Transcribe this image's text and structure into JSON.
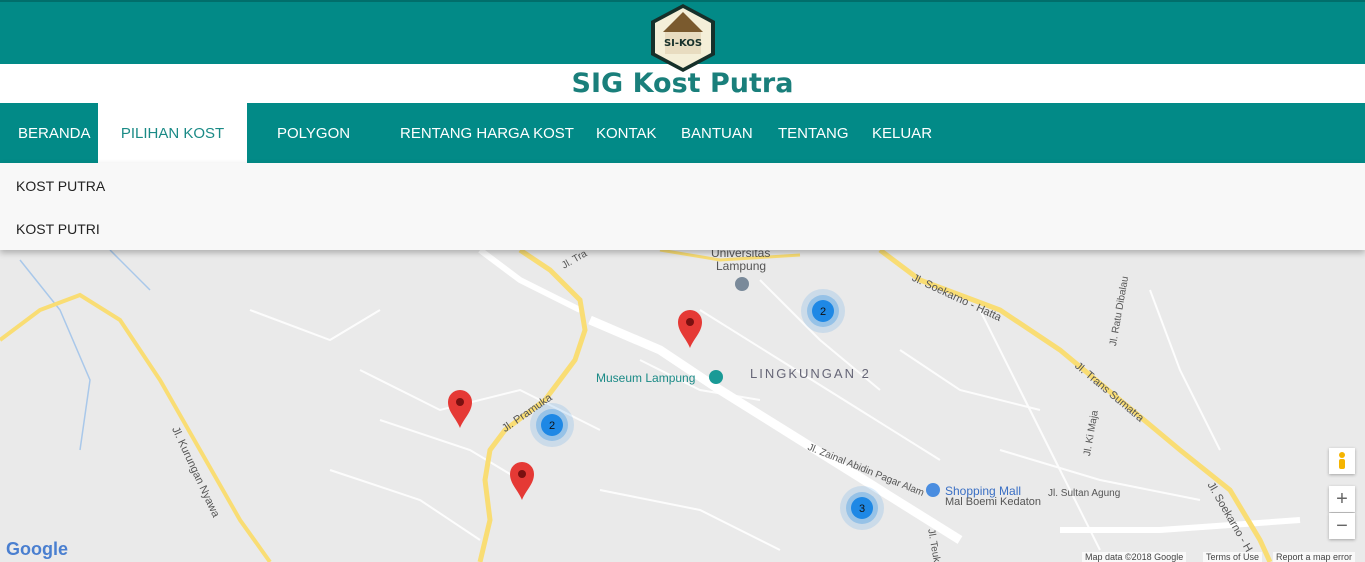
{
  "header": {
    "title": "SIG Kost Putra",
    "logo_text": "SI-KOS"
  },
  "nav": {
    "items": [
      {
        "label": "BERANDA"
      },
      {
        "label": "PILIHAN KOST"
      },
      {
        "label": "POLYGON"
      },
      {
        "label": "RENTANG HARGA KOST"
      },
      {
        "label": "KONTAK"
      },
      {
        "label": "BANTUAN"
      },
      {
        "label": "TENTANG"
      },
      {
        "label": "KELUAR"
      }
    ],
    "active": "PILIHAN KOST"
  },
  "dropdown": {
    "items": [
      {
        "label": "KOST PUTRA"
      },
      {
        "label": "KOST PUTRI"
      }
    ]
  },
  "map": {
    "labels": {
      "universitas": "Universitas",
      "lampung": "Lampung",
      "museum": "Museum Lampung",
      "lingkungan": "LINGKUNGAN 2",
      "shopping": "Shopping Mall",
      "mal": "Mal Boemi Kedaton",
      "soekarno": "Jl. Soekarno - Hatta",
      "trans": "Jl. Trans Sumatra",
      "pramuka": "Jl. Pramuka",
      "kurungan": "Jl. Kurungan Nyawa",
      "zainal": "Jl. Zainal Abidin Pagar Alam",
      "sultan": "Jl. Sultan Agung",
      "ratu": "Jl. Ratu Dibalau",
      "kimaja": "Jl. Ki Maja",
      "soekarno2": "Jl. Soekarno - H",
      "teuku": "Jl. Teuku",
      "tra": "Jl. Tra"
    },
    "clusters": [
      {
        "count": "2"
      },
      {
        "count": "2"
      },
      {
        "count": "3"
      }
    ],
    "zoom_in": "+",
    "zoom_out": "−",
    "attribution": "Map data ©2018 Google",
    "terms": "Terms of Use",
    "report": "Report a map error",
    "google": "Google"
  },
  "colors": {
    "teal": "#028a87",
    "marker": "#e53935",
    "cluster": "#1e88e5"
  }
}
